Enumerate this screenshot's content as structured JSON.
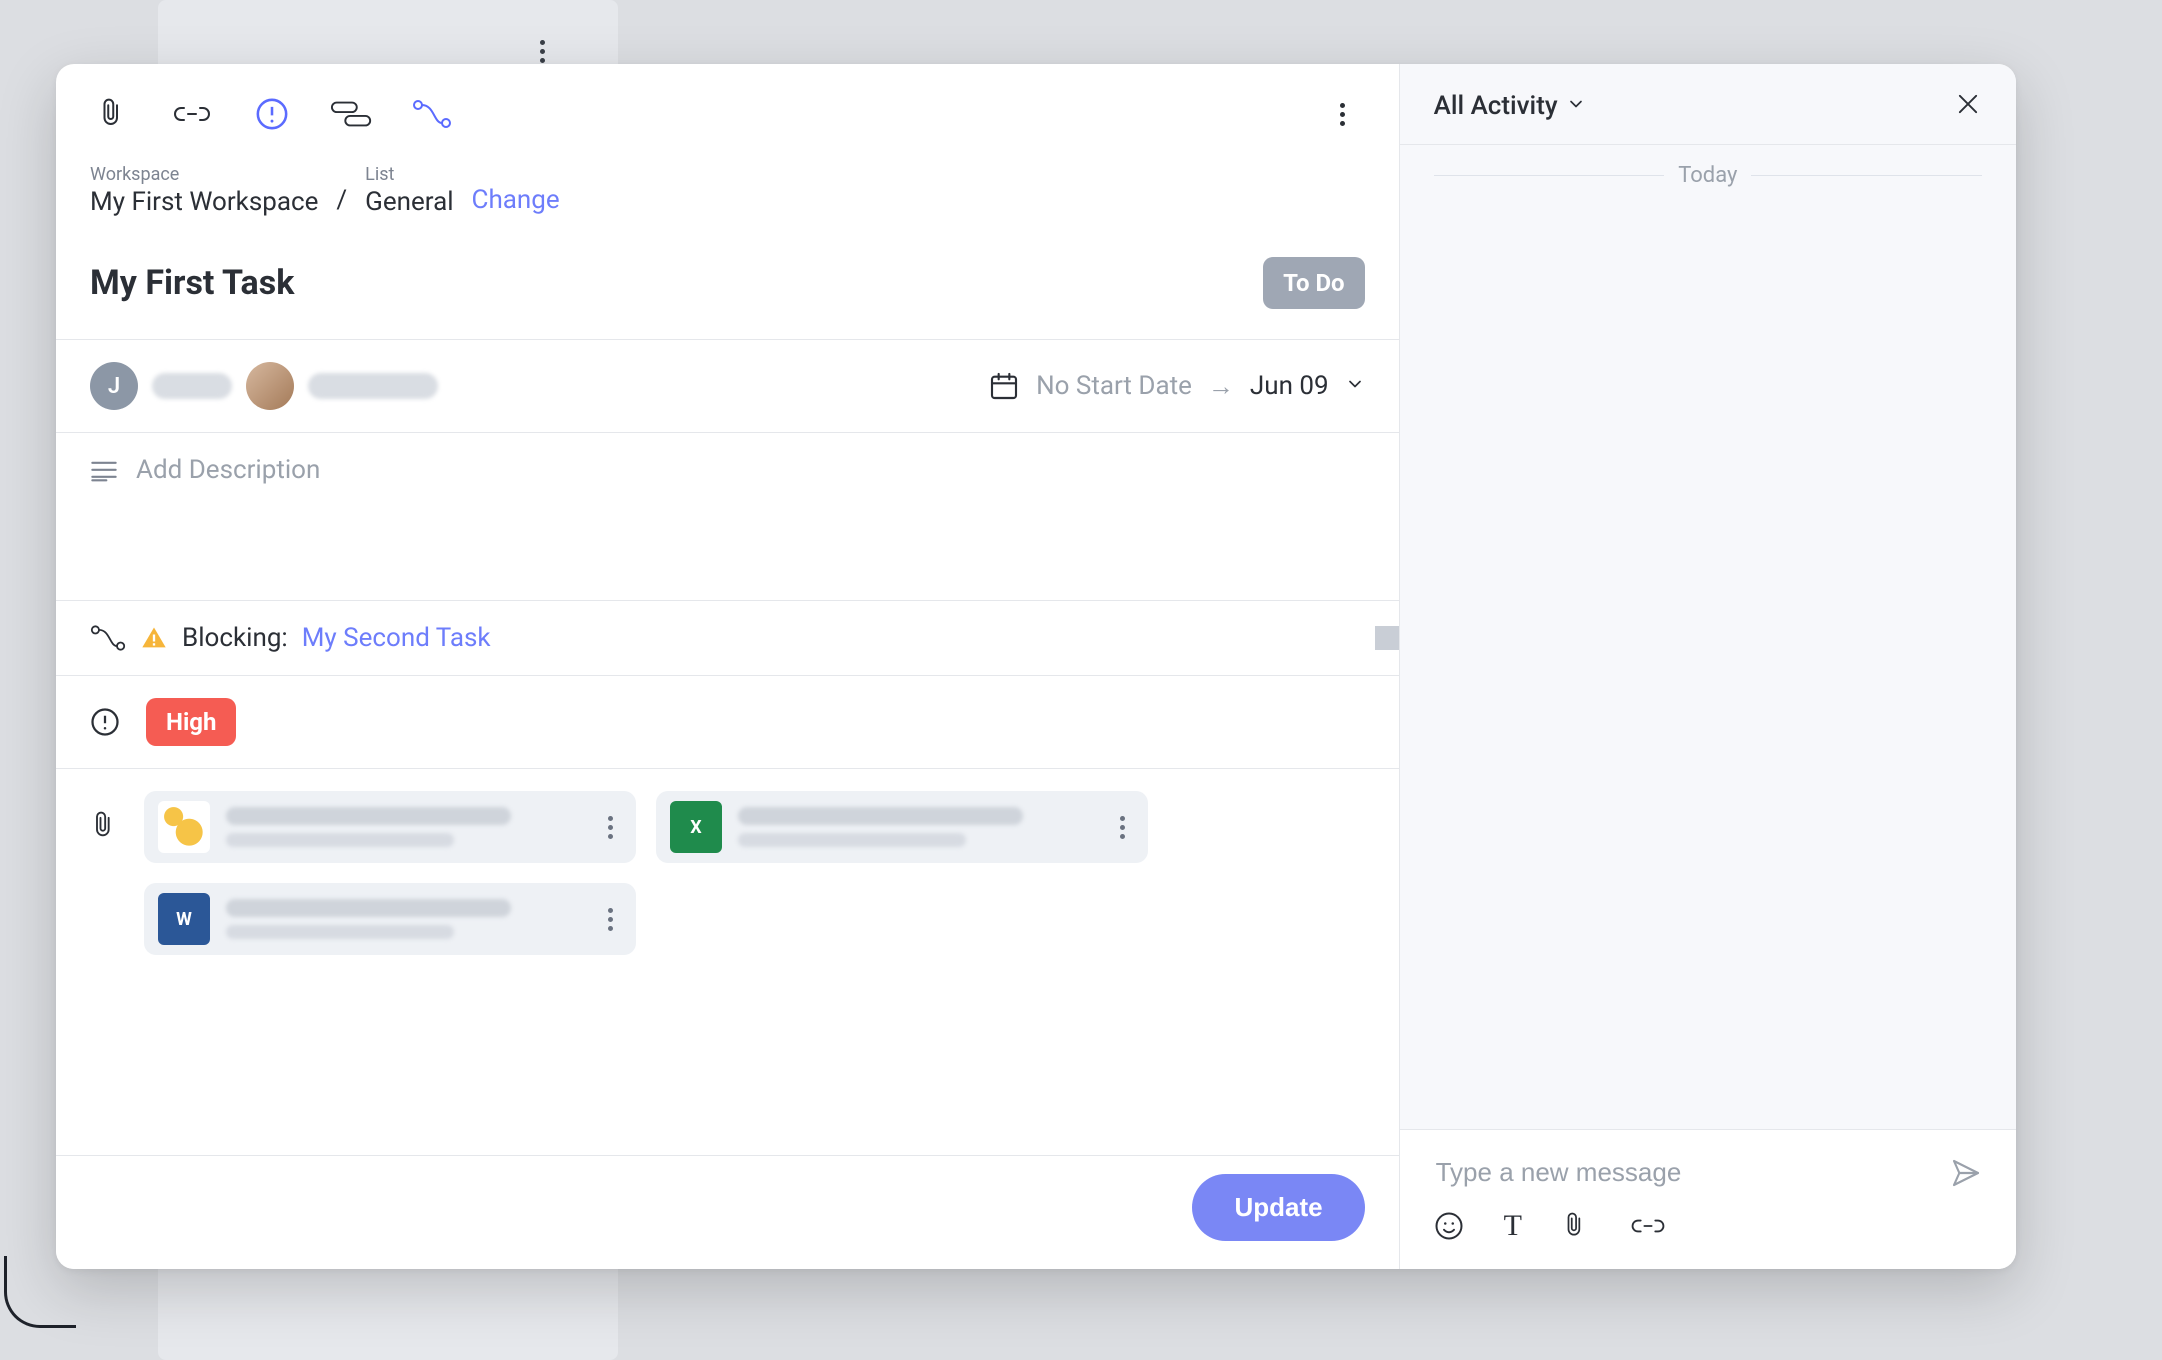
{
  "toolbar": {
    "icons": [
      "paperclip-icon",
      "link-icon",
      "priority-icon",
      "tags-icon",
      "dependency-icon"
    ]
  },
  "breadcrumb": {
    "workspace_label": "Workspace",
    "workspace_value": "My First Workspace",
    "list_label": "List",
    "list_value": "General",
    "change_label": "Change"
  },
  "task": {
    "title": "My First Task",
    "status": "To Do"
  },
  "assignees": {
    "initial": "J"
  },
  "dates": {
    "start_placeholder": "No Start Date",
    "due": "Jun 09"
  },
  "description": {
    "placeholder": "Add Description"
  },
  "dependency": {
    "label": "Blocking:",
    "linked_task": "My Second Task"
  },
  "priority": {
    "value": "High"
  },
  "attachments": {
    "count": 3,
    "items": [
      {
        "kind": "map"
      },
      {
        "kind": "excel",
        "glyph": "X"
      },
      {
        "kind": "word",
        "glyph": "W"
      }
    ]
  },
  "footer": {
    "update_label": "Update"
  },
  "activity": {
    "dropdown_label": "All Activity",
    "divider": "Today",
    "compose_placeholder": "Type a new message"
  }
}
